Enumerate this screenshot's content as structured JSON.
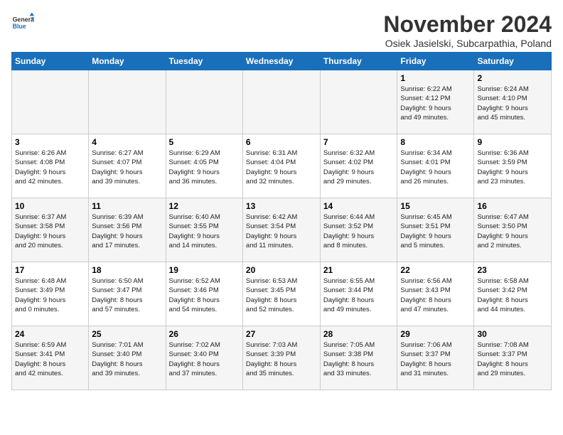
{
  "logo": {
    "text_general": "General",
    "text_blue": "Blue"
  },
  "header": {
    "month_title": "November 2024",
    "subtitle": "Osiek Jasielski, Subcarpathia, Poland"
  },
  "weekdays": [
    "Sunday",
    "Monday",
    "Tuesday",
    "Wednesday",
    "Thursday",
    "Friday",
    "Saturday"
  ],
  "weeks": [
    [
      {
        "day": "",
        "info": ""
      },
      {
        "day": "",
        "info": ""
      },
      {
        "day": "",
        "info": ""
      },
      {
        "day": "",
        "info": ""
      },
      {
        "day": "",
        "info": ""
      },
      {
        "day": "1",
        "info": "Sunrise: 6:22 AM\nSunset: 4:12 PM\nDaylight: 9 hours\nand 49 minutes."
      },
      {
        "day": "2",
        "info": "Sunrise: 6:24 AM\nSunset: 4:10 PM\nDaylight: 9 hours\nand 45 minutes."
      }
    ],
    [
      {
        "day": "3",
        "info": "Sunrise: 6:26 AM\nSunset: 4:08 PM\nDaylight: 9 hours\nand 42 minutes."
      },
      {
        "day": "4",
        "info": "Sunrise: 6:27 AM\nSunset: 4:07 PM\nDaylight: 9 hours\nand 39 minutes."
      },
      {
        "day": "5",
        "info": "Sunrise: 6:29 AM\nSunset: 4:05 PM\nDaylight: 9 hours\nand 36 minutes."
      },
      {
        "day": "6",
        "info": "Sunrise: 6:31 AM\nSunset: 4:04 PM\nDaylight: 9 hours\nand 32 minutes."
      },
      {
        "day": "7",
        "info": "Sunrise: 6:32 AM\nSunset: 4:02 PM\nDaylight: 9 hours\nand 29 minutes."
      },
      {
        "day": "8",
        "info": "Sunrise: 6:34 AM\nSunset: 4:01 PM\nDaylight: 9 hours\nand 26 minutes."
      },
      {
        "day": "9",
        "info": "Sunrise: 6:36 AM\nSunset: 3:59 PM\nDaylight: 9 hours\nand 23 minutes."
      }
    ],
    [
      {
        "day": "10",
        "info": "Sunrise: 6:37 AM\nSunset: 3:58 PM\nDaylight: 9 hours\nand 20 minutes."
      },
      {
        "day": "11",
        "info": "Sunrise: 6:39 AM\nSunset: 3:56 PM\nDaylight: 9 hours\nand 17 minutes."
      },
      {
        "day": "12",
        "info": "Sunrise: 6:40 AM\nSunset: 3:55 PM\nDaylight: 9 hours\nand 14 minutes."
      },
      {
        "day": "13",
        "info": "Sunrise: 6:42 AM\nSunset: 3:54 PM\nDaylight: 9 hours\nand 11 minutes."
      },
      {
        "day": "14",
        "info": "Sunrise: 6:44 AM\nSunset: 3:52 PM\nDaylight: 9 hours\nand 8 minutes."
      },
      {
        "day": "15",
        "info": "Sunrise: 6:45 AM\nSunset: 3:51 PM\nDaylight: 9 hours\nand 5 minutes."
      },
      {
        "day": "16",
        "info": "Sunrise: 6:47 AM\nSunset: 3:50 PM\nDaylight: 9 hours\nand 2 minutes."
      }
    ],
    [
      {
        "day": "17",
        "info": "Sunrise: 6:48 AM\nSunset: 3:49 PM\nDaylight: 9 hours\nand 0 minutes."
      },
      {
        "day": "18",
        "info": "Sunrise: 6:50 AM\nSunset: 3:47 PM\nDaylight: 8 hours\nand 57 minutes."
      },
      {
        "day": "19",
        "info": "Sunrise: 6:52 AM\nSunset: 3:46 PM\nDaylight: 8 hours\nand 54 minutes."
      },
      {
        "day": "20",
        "info": "Sunrise: 6:53 AM\nSunset: 3:45 PM\nDaylight: 8 hours\nand 52 minutes."
      },
      {
        "day": "21",
        "info": "Sunrise: 6:55 AM\nSunset: 3:44 PM\nDaylight: 8 hours\nand 49 minutes."
      },
      {
        "day": "22",
        "info": "Sunrise: 6:56 AM\nSunset: 3:43 PM\nDaylight: 8 hours\nand 47 minutes."
      },
      {
        "day": "23",
        "info": "Sunrise: 6:58 AM\nSunset: 3:42 PM\nDaylight: 8 hours\nand 44 minutes."
      }
    ],
    [
      {
        "day": "24",
        "info": "Sunrise: 6:59 AM\nSunset: 3:41 PM\nDaylight: 8 hours\nand 42 minutes."
      },
      {
        "day": "25",
        "info": "Sunrise: 7:01 AM\nSunset: 3:40 PM\nDaylight: 8 hours\nand 39 minutes."
      },
      {
        "day": "26",
        "info": "Sunrise: 7:02 AM\nSunset: 3:40 PM\nDaylight: 8 hours\nand 37 minutes."
      },
      {
        "day": "27",
        "info": "Sunrise: 7:03 AM\nSunset: 3:39 PM\nDaylight: 8 hours\nand 35 minutes."
      },
      {
        "day": "28",
        "info": "Sunrise: 7:05 AM\nSunset: 3:38 PM\nDaylight: 8 hours\nand 33 minutes."
      },
      {
        "day": "29",
        "info": "Sunrise: 7:06 AM\nSunset: 3:37 PM\nDaylight: 8 hours\nand 31 minutes."
      },
      {
        "day": "30",
        "info": "Sunrise: 7:08 AM\nSunset: 3:37 PM\nDaylight: 8 hours\nand 29 minutes."
      }
    ]
  ]
}
